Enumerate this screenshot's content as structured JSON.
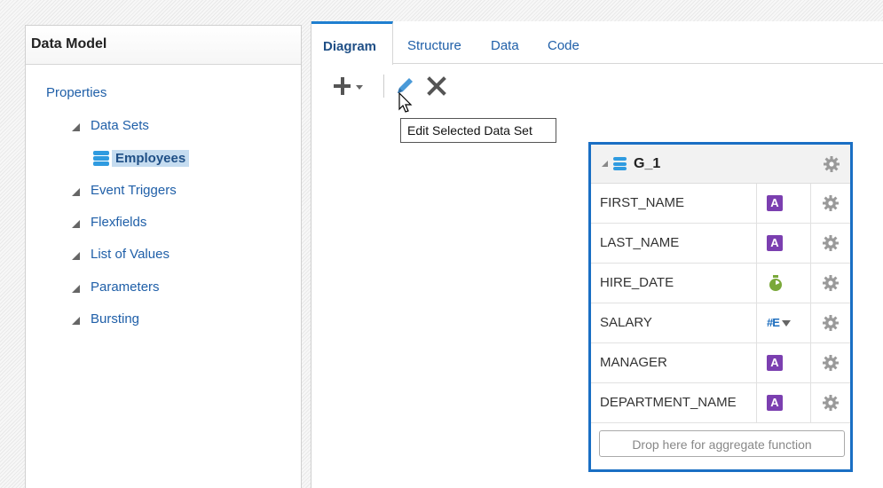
{
  "left_panel": {
    "title": "Data Model",
    "properties_label": "Properties",
    "tree": [
      {
        "label": "Data Sets",
        "children": [
          {
            "label": "Employees"
          }
        ]
      },
      {
        "label": "Event Triggers"
      },
      {
        "label": "Flexfields"
      },
      {
        "label": "List of Values"
      },
      {
        "label": "Parameters"
      },
      {
        "label": "Bursting"
      }
    ]
  },
  "tabs": [
    "Diagram",
    "Structure",
    "Data",
    "Code"
  ],
  "active_tab": "Diagram",
  "toolbar": {
    "add_icon": "plus-icon",
    "edit_icon": "pencil-icon",
    "delete_icon": "close-icon",
    "tooltip": "Edit Selected Data Set"
  },
  "group": {
    "title": "G_1",
    "columns": [
      {
        "name": "FIRST_NAME",
        "type_icon": "text-type-icon",
        "type_label": "A"
      },
      {
        "name": "LAST_NAME",
        "type_icon": "text-type-icon",
        "type_label": "A"
      },
      {
        "name": "HIRE_DATE",
        "type_icon": "date-type-icon",
        "type_label": ""
      },
      {
        "name": "SALARY",
        "type_icon": "number-type-icon",
        "type_label": "#E"
      },
      {
        "name": "MANAGER",
        "type_icon": "text-type-icon",
        "type_label": "A"
      },
      {
        "name": "DEPARTMENT_NAME",
        "type_icon": "text-type-icon",
        "type_label": "A"
      }
    ],
    "drop_zone": "Drop here for aggregate function"
  },
  "colors": {
    "accent_blue": "#1a6fc4",
    "link_blue": "#1f5fa8",
    "text_type_purple": "#7b3fb0",
    "date_type_green": "#7aa83a"
  }
}
